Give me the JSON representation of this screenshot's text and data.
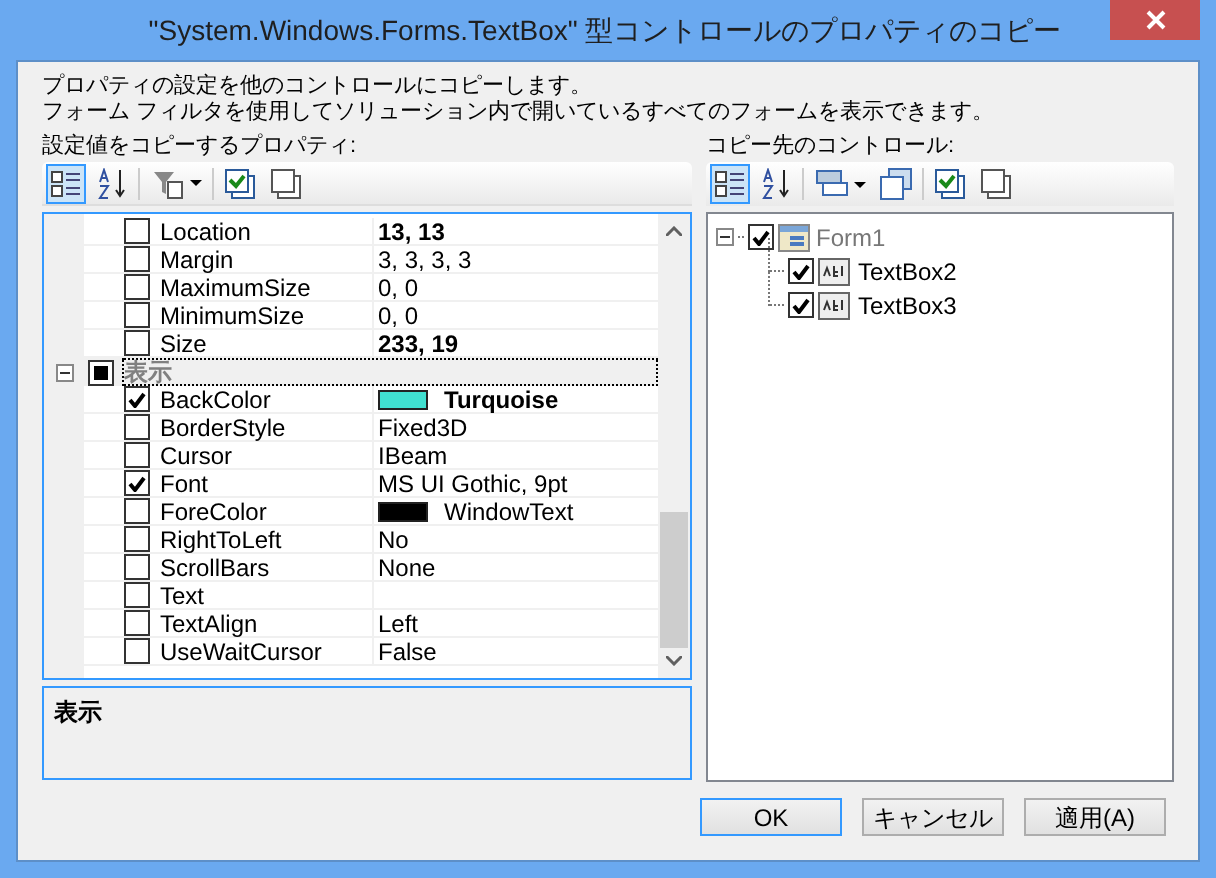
{
  "window": {
    "title": "\"System.Windows.Forms.TextBox\" 型コントロールのプロパティのコピー"
  },
  "intro": [
    "プロパティの設定を他のコントロールにコピーします。",
    "フォーム フィルタを使用してソリューション内で開いているすべてのフォームを表示できます。"
  ],
  "source": {
    "label": "設定値をコピーするプロパティ:",
    "rows": [
      {
        "kind": "property",
        "name": "Location",
        "value": "13, 13",
        "checked": false,
        "bold": true
      },
      {
        "kind": "property",
        "name": "Margin",
        "value": "3, 3, 3, 3",
        "checked": false,
        "bold": false
      },
      {
        "kind": "property",
        "name": "MaximumSize",
        "value": "0, 0",
        "checked": false,
        "bold": false
      },
      {
        "kind": "property",
        "name": "MinimumSize",
        "value": "0, 0",
        "checked": false,
        "bold": false
      },
      {
        "kind": "property",
        "name": "Size",
        "value": "233, 19",
        "checked": false,
        "bold": true
      },
      {
        "kind": "category",
        "name": "表示",
        "expanded": true,
        "selected": true,
        "checked": true
      },
      {
        "kind": "property",
        "name": "BackColor",
        "value": "Turquoise",
        "checked": true,
        "bold": true,
        "color": "#40e0d0"
      },
      {
        "kind": "property",
        "name": "BorderStyle",
        "value": "Fixed3D",
        "checked": false,
        "bold": false
      },
      {
        "kind": "property",
        "name": "Cursor",
        "value": "IBeam",
        "checked": false,
        "bold": false
      },
      {
        "kind": "property",
        "name": "Font",
        "value": "MS UI Gothic, 9pt",
        "checked": true,
        "bold": false
      },
      {
        "kind": "property",
        "name": "ForeColor",
        "value": "WindowText",
        "checked": false,
        "bold": false,
        "color": "#000000"
      },
      {
        "kind": "property",
        "name": "RightToLeft",
        "value": "No",
        "checked": false,
        "bold": false
      },
      {
        "kind": "property",
        "name": "ScrollBars",
        "value": "None",
        "checked": false,
        "bold": false
      },
      {
        "kind": "property",
        "name": "Text",
        "checked": false
      },
      {
        "kind": "property",
        "name": "TextAlign",
        "value": "Left",
        "checked": false,
        "bold": false
      },
      {
        "kind": "property",
        "name": "UseWaitCursor",
        "value": "False",
        "checked": false,
        "bold": false
      }
    ],
    "description": "表示"
  },
  "target": {
    "label": "コピー先のコントロール:",
    "tree": [
      {
        "name": "Form1",
        "checked": true,
        "expanded": true,
        "children": [
          {
            "name": "TextBox2",
            "checked": true
          },
          {
            "name": "TextBox3",
            "checked": true
          }
        ]
      }
    ]
  },
  "buttons": [
    {
      "label": "OK",
      "selected": true
    },
    {
      "label": "キャンセル",
      "selected": false
    },
    {
      "label": "適用(A)",
      "selected": false
    }
  ]
}
